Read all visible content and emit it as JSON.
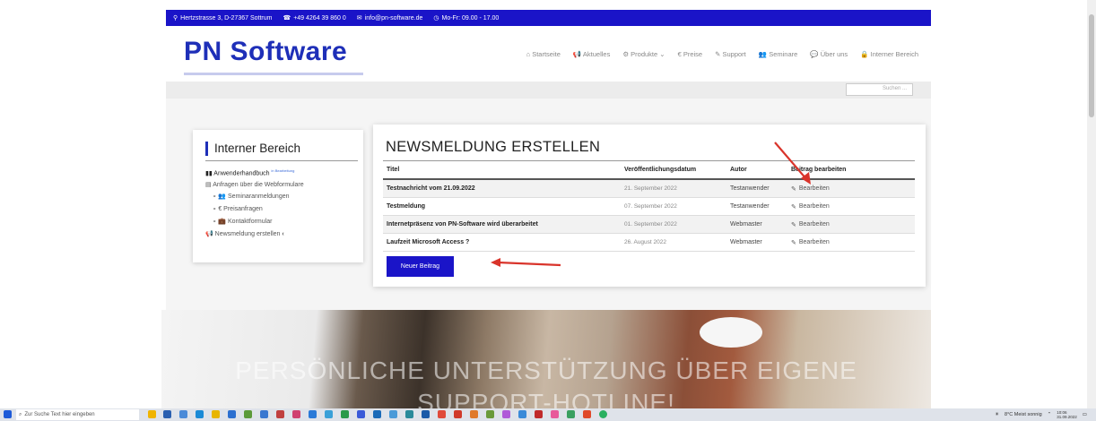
{
  "topbar": {
    "address": "Hertzstrasse 3, D-27367 Sottrum",
    "phone": "+49 4264 39 860 0",
    "email": "info@pn-software.de",
    "hours": "Mo-Fr: 09.00 - 17.00"
  },
  "logo": "PN Software",
  "nav": [
    "Startseite",
    "Aktuelles",
    "Produkte",
    "€ Preise",
    "Support",
    "Seminare",
    "Über uns",
    "Interner Bereich"
  ],
  "search": {
    "placeholder": "Suchen ..."
  },
  "sidebar": {
    "title": "Interner Bereich",
    "items": [
      {
        "label": "Anwenderhandbuch",
        "badge": "in Bearbeitung"
      },
      {
        "label": "Anfragen über die Webformulare"
      },
      {
        "label": "Seminaranmeldungen"
      },
      {
        "label": "€ Preisanfragen"
      },
      {
        "label": "Kontaktformular"
      },
      {
        "label": "Newsmeldung erstellen"
      }
    ]
  },
  "main": {
    "title": "NEWSMELDUNG ERSTELLEN",
    "columns": [
      "Titel",
      "Veröffentlichungsdatum",
      "Autor",
      "Beitrag bearbeiten"
    ],
    "rows": [
      {
        "title": "Testnachricht vom 21.09.2022",
        "date": "21. September 2022",
        "author": "Testanwender",
        "action": "Bearbeiten"
      },
      {
        "title": "Testmeldung",
        "date": "07. September 2022",
        "author": "Testanwender",
        "action": "Bearbeiten"
      },
      {
        "title": "Internetpräsenz von PN-Software wird überarbeitet",
        "date": "01. September 2022",
        "author": "Webmaster",
        "action": "Bearbeiten"
      },
      {
        "title": "Laufzeit Microsoft Access ?",
        "date": "26. August 2022",
        "author": "Webmaster",
        "action": "Bearbeiten"
      }
    ],
    "new_button": "Neuer Beitrag"
  },
  "hero": {
    "line1": "PERSÖNLICHE UNTERSTÜTZUNG ÜBER EIGENE",
    "line2": "SUPPORT-HOTLINE!"
  },
  "taskbar": {
    "search_placeholder": "Zur Suche Text hier eingeben",
    "weather": "8°C Meist sonnig",
    "time": "10:06",
    "date": "31.09.2022"
  },
  "colors": {
    "brand": "#1a14c8",
    "logo": "#1e2fb8",
    "arrow": "#d9342b"
  }
}
